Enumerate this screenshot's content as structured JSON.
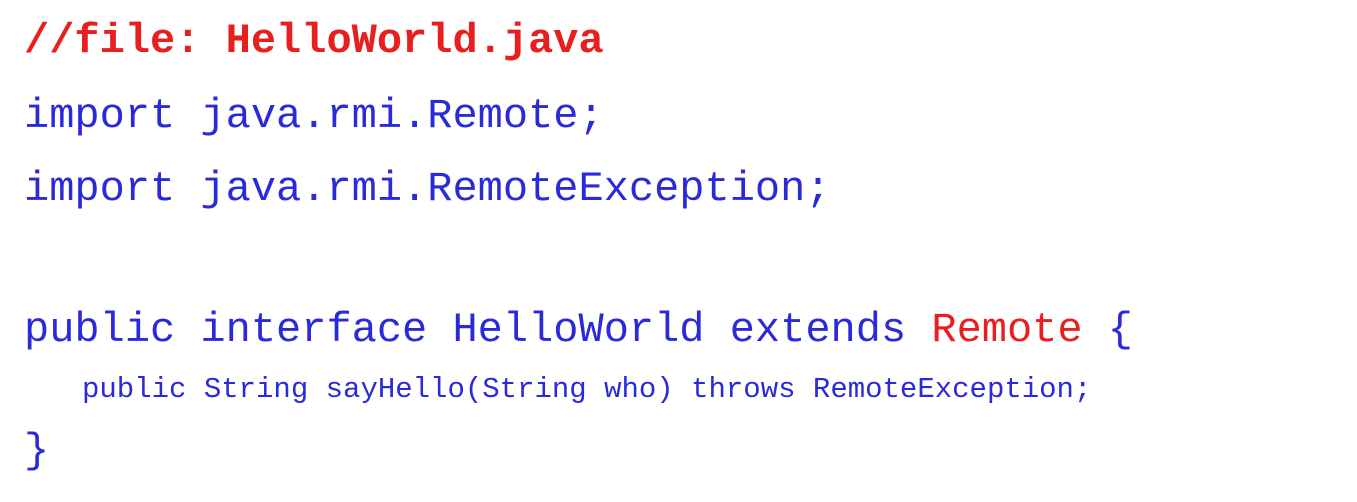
{
  "code": {
    "comment": "//file: HelloWorld.java",
    "import1": "import java.rmi.Remote;",
    "import2": "import java.rmi.RemoteException;",
    "decl_prefix": "public interface HelloWorld extends ",
    "decl_super": "Remote",
    "decl_suffix": " {",
    "method": "public String sayHello(String who) throws RemoteException;",
    "close": "}"
  },
  "colors": {
    "code_text": "#2a2ad8",
    "highlight": "#e81f1f",
    "background": "#ffffff"
  }
}
